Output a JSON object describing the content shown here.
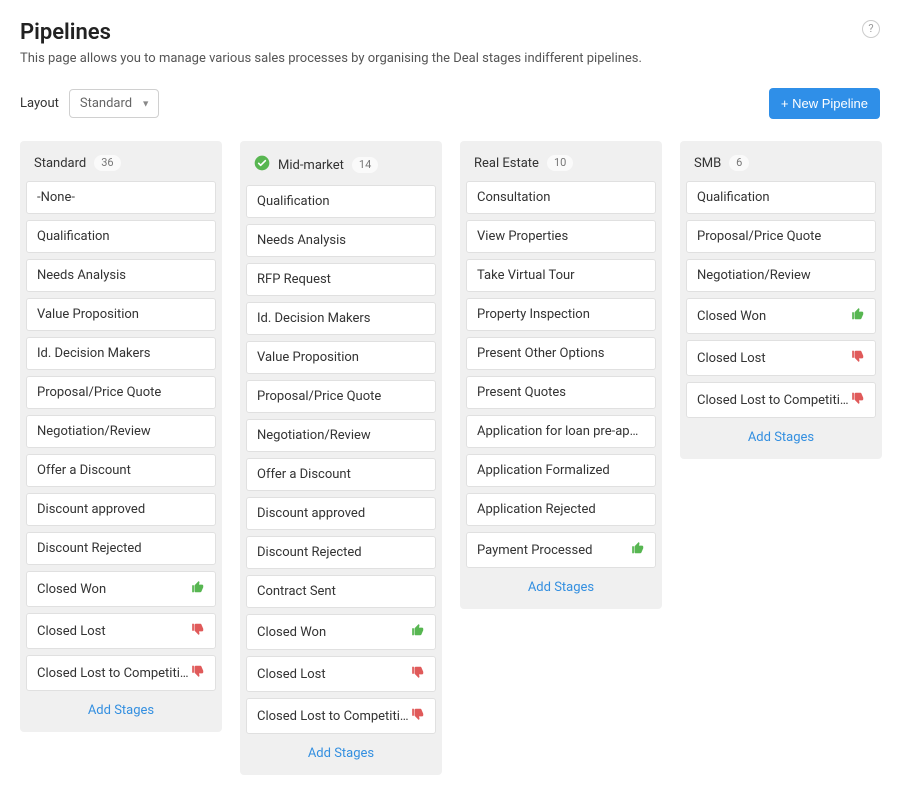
{
  "header": {
    "title": "Pipelines",
    "subtitle": "This page allows you to manage various sales processes by organising the Deal stages indifferent pipelines.",
    "help_tooltip": "?"
  },
  "toolbar": {
    "layout_label": "Layout",
    "layout_value": "Standard",
    "new_pipeline_label": "+ New Pipeline"
  },
  "colors": {
    "primary": "#2f8fe8",
    "thumb_up": "#57b651",
    "thumb_down": "#e05a5a"
  },
  "add_stages_label": "Add Stages",
  "pipelines": [
    {
      "name": "Standard",
      "count": 36,
      "checked": false,
      "stages": [
        {
          "label": "-None-",
          "status": "none"
        },
        {
          "label": "Qualification",
          "status": "none"
        },
        {
          "label": "Needs Analysis",
          "status": "none"
        },
        {
          "label": "Value Proposition",
          "status": "none"
        },
        {
          "label": "Id. Decision Makers",
          "status": "none"
        },
        {
          "label": "Proposal/Price Quote",
          "status": "none"
        },
        {
          "label": "Negotiation/Review",
          "status": "none"
        },
        {
          "label": "Offer a Discount",
          "status": "none"
        },
        {
          "label": "Discount approved",
          "status": "none"
        },
        {
          "label": "Discount Rejected",
          "status": "none"
        },
        {
          "label": "Closed Won",
          "status": "won"
        },
        {
          "label": "Closed Lost",
          "status": "lost"
        },
        {
          "label": "Closed Lost to Competition",
          "status": "lost"
        }
      ]
    },
    {
      "name": "Mid-market",
      "count": 14,
      "checked": true,
      "stages": [
        {
          "label": "Qualification",
          "status": "none"
        },
        {
          "label": "Needs Analysis",
          "status": "none"
        },
        {
          "label": "RFP Request",
          "status": "none"
        },
        {
          "label": "Id. Decision Makers",
          "status": "none"
        },
        {
          "label": "Value Proposition",
          "status": "none"
        },
        {
          "label": "Proposal/Price Quote",
          "status": "none"
        },
        {
          "label": "Negotiation/Review",
          "status": "none"
        },
        {
          "label": "Offer a Discount",
          "status": "none"
        },
        {
          "label": "Discount approved",
          "status": "none"
        },
        {
          "label": "Discount Rejected",
          "status": "none"
        },
        {
          "label": "Contract Sent",
          "status": "none"
        },
        {
          "label": "Closed Won",
          "status": "won"
        },
        {
          "label": "Closed Lost",
          "status": "lost"
        },
        {
          "label": "Closed Lost to Competition",
          "status": "lost"
        }
      ]
    },
    {
      "name": "Real Estate",
      "count": 10,
      "checked": false,
      "stages": [
        {
          "label": "Consultation",
          "status": "none"
        },
        {
          "label": "View Properties",
          "status": "none"
        },
        {
          "label": "Take Virtual Tour",
          "status": "none"
        },
        {
          "label": "Property Inspection",
          "status": "none"
        },
        {
          "label": "Present Other Options",
          "status": "none"
        },
        {
          "label": "Present Quotes",
          "status": "none"
        },
        {
          "label": "Application for loan pre-approval",
          "status": "none"
        },
        {
          "label": "Application Formalized",
          "status": "none"
        },
        {
          "label": "Application Rejected",
          "status": "none"
        },
        {
          "label": "Payment Processed",
          "status": "won"
        }
      ]
    },
    {
      "name": "SMB",
      "count": 6,
      "checked": false,
      "stages": [
        {
          "label": "Qualification",
          "status": "none"
        },
        {
          "label": "Proposal/Price Quote",
          "status": "none"
        },
        {
          "label": "Negotiation/Review",
          "status": "none"
        },
        {
          "label": "Closed Won",
          "status": "won"
        },
        {
          "label": "Closed Lost",
          "status": "lost"
        },
        {
          "label": "Closed Lost to Competition",
          "status": "lost"
        }
      ]
    }
  ]
}
